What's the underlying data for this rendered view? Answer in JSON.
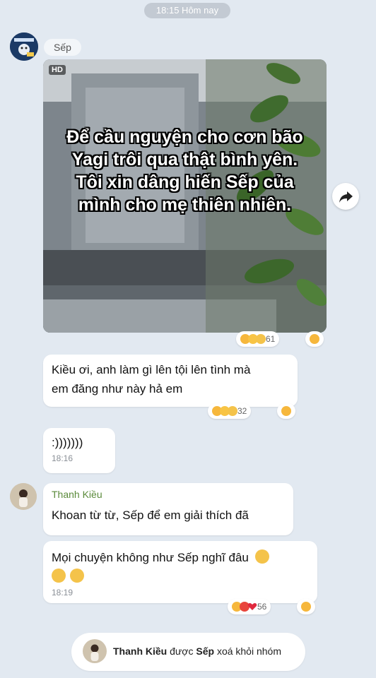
{
  "timestamp_divider": "18:15 Hôm nay",
  "boss": {
    "name": "Sếp"
  },
  "video_message": {
    "badge": "HD",
    "caption_lines": [
      "Để cầu nguyện cho cơn bão",
      "Yagi trôi qua thật bình yên.",
      "Tôi xin dâng hiến Sếp của",
      "mình cho mẹ thiên nhiên."
    ],
    "reaction_count": "61"
  },
  "messages": [
    {
      "text_lines": [
        "Kiều ơi, anh làm gì lên tội lên tình mà",
        "em đăng như này hả em"
      ],
      "reaction_count": "32"
    },
    {
      "text": ":)))))))",
      "time": "18:16"
    }
  ],
  "kieu": {
    "name": "Thanh Kiều",
    "messages": [
      {
        "text": "Khoan từ từ, Sếp để em giải thích đã"
      },
      {
        "text": "Mọi chuyện không như Sếp nghĩ đâu",
        "time": "18:19",
        "reaction_count": "56"
      }
    ]
  },
  "system_notice": {
    "actor": "Thanh Kiều",
    "verb": "được",
    "target": "Sếp",
    "action": "xoá khỏi nhóm"
  },
  "colors": {
    "background": "#e2e9f1",
    "sender_name": "#5a8a3a",
    "share_icon": "#222222"
  },
  "icons": [
    "share-arrow-icon",
    "laugh-emoji",
    "shock-emoji",
    "cry-emoji",
    "angry-emoji",
    "heart-emoji"
  ]
}
